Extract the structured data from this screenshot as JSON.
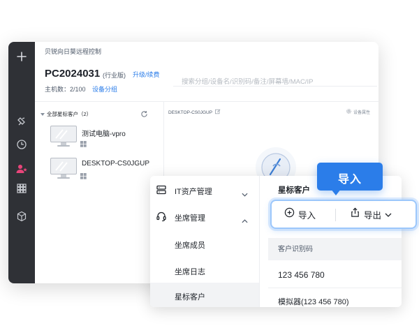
{
  "app": {
    "title": "贝锐向日葵远程控制",
    "device_name": "PC2024031",
    "edition": "(行业版)",
    "upgrade_link": "升级/续费",
    "host_count": "主机数：2/100",
    "group_link": "设备分组",
    "search_placeholder": "搜索分组/设备名/识别码/备注/屏幕墙/MAC/IP",
    "tree": {
      "header": "全部星标客户（2）",
      "devices": [
        {
          "label": "测试电脑-vpro"
        },
        {
          "label": "DESKTOP-CS0JGUP"
        }
      ]
    },
    "detail": {
      "title": "DESKTOP-CS0JGUP",
      "properties_label": "设备属性"
    }
  },
  "menu": {
    "items": [
      {
        "label": "IT资产管理",
        "icon": "server-icon",
        "chevron": "chevron-down-icon"
      },
      {
        "label": "坐席管理",
        "icon": "headset-icon",
        "chevron": "chevron-up-icon"
      },
      {
        "label": "坐席成员"
      },
      {
        "label": "坐席日志"
      },
      {
        "label": "星标客户",
        "selected": true
      }
    ]
  },
  "content": {
    "title": "星标客户",
    "column_header": "客户识别码",
    "rows": [
      "123 456 780",
      "模拟器(123 456 780)"
    ]
  },
  "toolbar": {
    "import_label": "导入",
    "export_label": "导出"
  },
  "callout": {
    "label": "导入"
  },
  "colors": {
    "accent": "#2b7de9",
    "rail_bg": "#2f3136",
    "rail_active": "#e8457a",
    "selected_bg": "#f2f3f5"
  }
}
